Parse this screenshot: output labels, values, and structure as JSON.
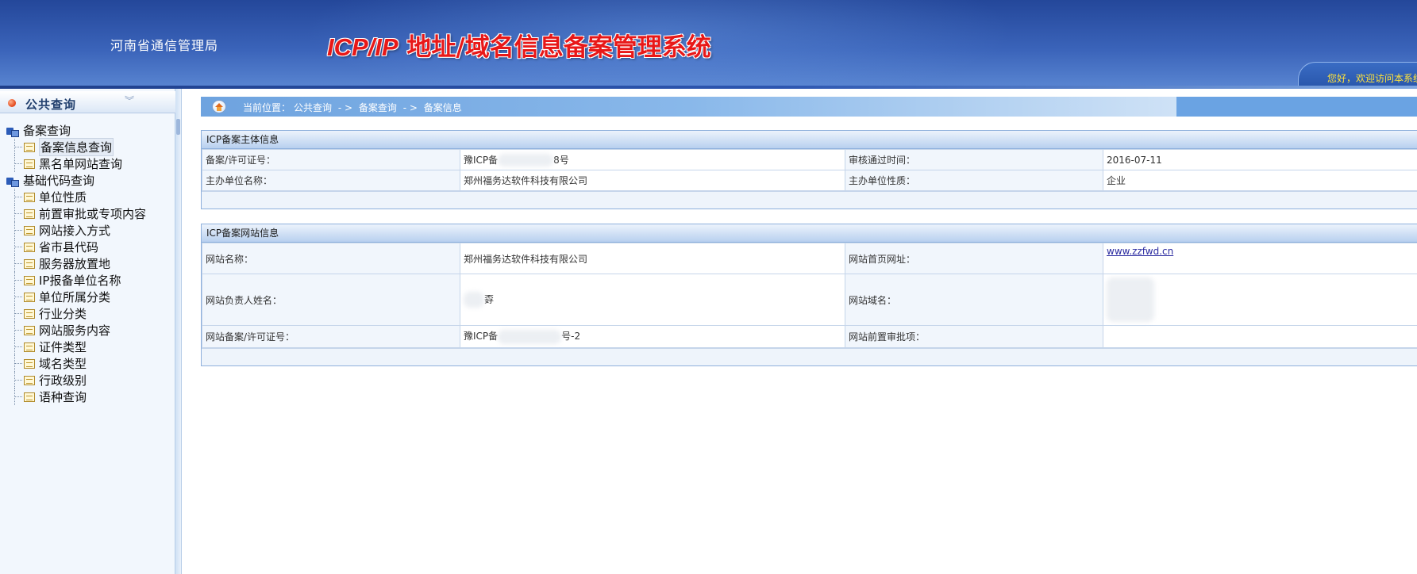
{
  "header": {
    "org_name": "河南省通信管理局",
    "title_latin": "ICP/IP",
    "title_cn": " 地址/域名信息备案管理系统",
    "welcome": "您好，欢迎访问本系统"
  },
  "sidebar": {
    "title": "公共查询",
    "groups": [
      {
        "label": "备案查询",
        "items": [
          "备案信息查询",
          "黑名单网站查询"
        ]
      },
      {
        "label": "基础代码查询",
        "items": [
          "单位性质",
          "前置审批或专项内容",
          "网站接入方式",
          "省市县代码",
          "服务器放置地",
          "IP报备单位名称",
          "单位所属分类",
          "行业分类",
          "网站服务内容",
          "证件类型",
          "域名类型",
          "行政级别",
          "语种查询"
        ]
      }
    ],
    "selected": "备案信息查询"
  },
  "breadcrumb": {
    "prefix": "当前位置：",
    "items": [
      "公共查询",
      "备案查询",
      "备案信息"
    ],
    "separator": " - > "
  },
  "entity_panel": {
    "title": "ICP备案主体信息",
    "license_label": "备案/许可证号：",
    "license_prefix": "豫ICP备",
    "license_suffix": "8号",
    "approved_label": "审核通过时间：",
    "approved_value": "2016-07-11",
    "org_label": "主办单位名称：",
    "org_value": "郑州福务达软件科技有限公司",
    "org_type_label": "主办单位性质：",
    "org_type_value": "企业"
  },
  "site_panel": {
    "title": "ICP备案网站信息",
    "site_name_label": "网站名称：",
    "site_name_value": "郑州福务达软件科技有限公司",
    "homepage_label": "网站首页网址：",
    "homepage_value": "www.zzfwd.cn",
    "owner_label": "网站负责人姓名：",
    "owner_fragment": "孬",
    "domain_label": "网站域名：",
    "domain_fragment": "",
    "site_license_label": "网站备案/许可证号：",
    "site_license_prefix": "豫ICP备",
    "site_license_suffix": "号-2",
    "preapproval_label": "网站前置审批项：",
    "preapproval_value": ""
  }
}
